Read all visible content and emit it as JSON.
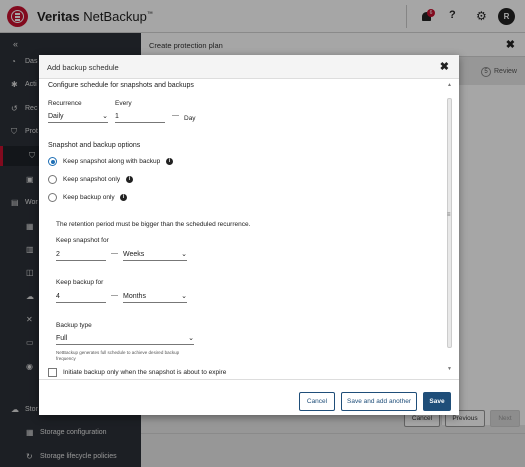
{
  "header": {
    "brand_bold": "Veritas",
    "brand_light": "NetBackup",
    "brand_tm": "™",
    "notification_count": "6",
    "help_glyph": "?",
    "avatar_initial": "R"
  },
  "sidebar": {
    "collapse_glyph": "«",
    "items": [
      {
        "label": "Das",
        "icon": "dashboard-icon"
      },
      {
        "label": "Acti",
        "icon": "activity-icon"
      },
      {
        "label": "Rec",
        "icon": "recovery-icon"
      },
      {
        "label": "Prot",
        "icon": "shield-icon"
      },
      {
        "label": "",
        "icon": "protection-plans-icon"
      },
      {
        "label": "",
        "icon": "policies-icon"
      },
      {
        "label": "Wor",
        "icon": "workloads-icon"
      },
      {
        "label": "",
        "icon": "workload-db-icon"
      },
      {
        "label": "",
        "icon": "workload-app-icon"
      },
      {
        "label": "",
        "icon": "workload-vm-icon"
      },
      {
        "label": "",
        "icon": "workload-cloud-icon"
      },
      {
        "label": "",
        "icon": "workload-k8s-icon"
      },
      {
        "label": "",
        "icon": "workload-nas-icon"
      },
      {
        "label": "",
        "icon": "workload-other-icon"
      },
      {
        "label": "Stor",
        "icon": "storage-icon"
      },
      {
        "label": "Storage configuration",
        "icon": "storage-config-icon"
      },
      {
        "label": "Storage lifecycle policies",
        "icon": "slp-icon"
      }
    ]
  },
  "main": {
    "title": "Create protection plan",
    "review_step_number": "5",
    "review_step_label": "Review",
    "footer": {
      "cancel": "Cancel",
      "previous": "Previous",
      "next": "Next"
    }
  },
  "dialog": {
    "title": "Add backup schedule",
    "subtitle": "Configure schedule for snapshots and backups",
    "recurrence_label": "Recurrence",
    "recurrence_value": "Daily",
    "every_label": "Every",
    "every_value": "1",
    "every_unit": "Day",
    "snapshot_options_heading": "Snapshot and backup options",
    "options": [
      {
        "label": "Keep snapshot along with backup",
        "selected": true
      },
      {
        "label": "Keep snapshot only",
        "selected": false
      },
      {
        "label": "Keep backup only",
        "selected": false
      }
    ],
    "retention_note": "The retention period must be bigger than the scheduled recurrence.",
    "keep_snapshot_label": "Keep snapshot for",
    "keep_snapshot_value": "2",
    "keep_snapshot_unit": "Weeks",
    "keep_backup_label": "Keep backup for",
    "keep_backup_value": "4",
    "keep_backup_unit": "Months",
    "backup_type_label": "Backup type",
    "backup_type_value": "Full",
    "backup_type_help_line1": "NetBackup generates full schedule to achieve desired backup",
    "backup_type_help_line2": "frequency",
    "initiate_checkbox_label": "Initiate backup only when the snapshot is about to expire",
    "buttons": {
      "cancel": "Cancel",
      "save_add": "Save and add another",
      "save": "Save"
    }
  },
  "colors": {
    "brand_red": "#c8102e",
    "primary_blue": "#1f4e79",
    "radio_blue": "#1f6fb5",
    "sidebar_bg": "#2b3038"
  }
}
